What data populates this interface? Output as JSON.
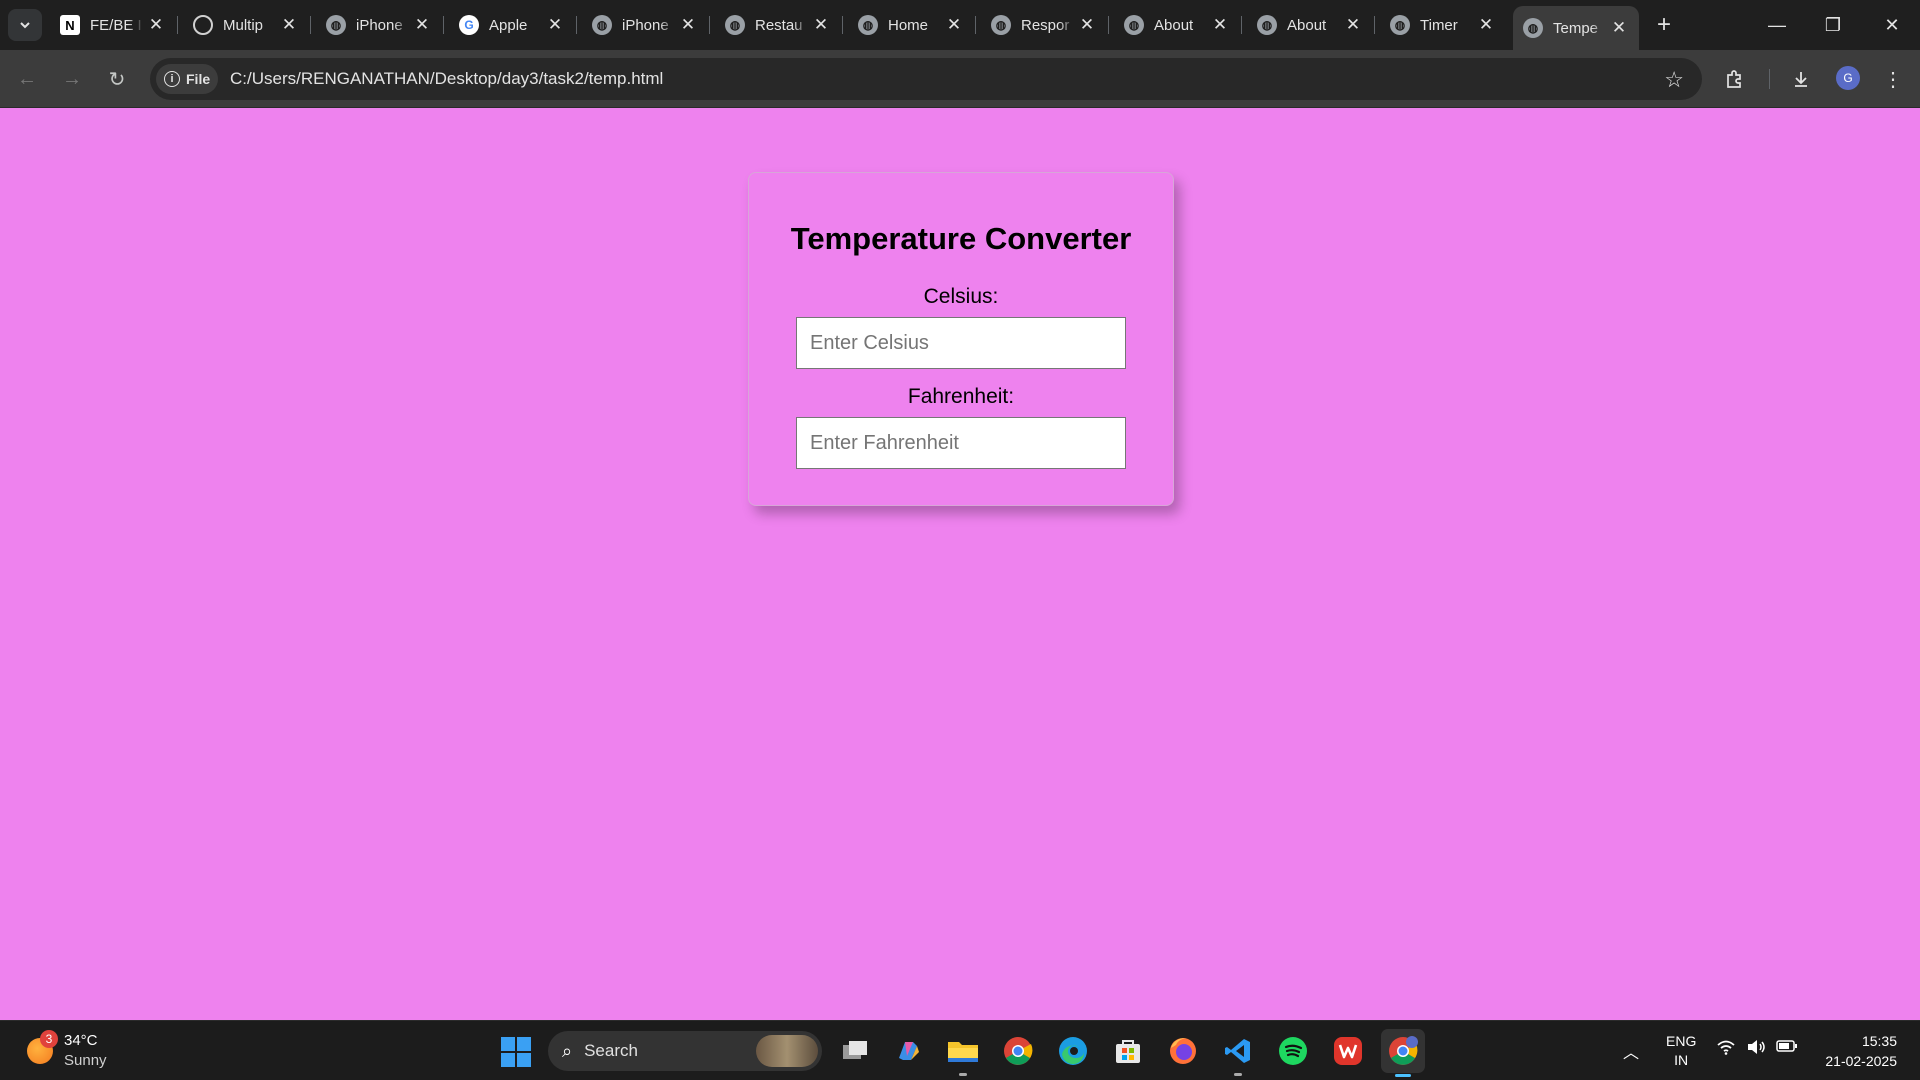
{
  "browser": {
    "tabs": [
      {
        "title": "FE/BE I",
        "favicon": "notion-icon"
      },
      {
        "title": "Multip",
        "favicon": "openai-icon"
      },
      {
        "title": "iPhone",
        "favicon": "globe-icon"
      },
      {
        "title": "Apple",
        "favicon": "google-icon"
      },
      {
        "title": "iPhone",
        "favicon": "globe-icon"
      },
      {
        "title": "Restau",
        "favicon": "globe-icon"
      },
      {
        "title": "Home",
        "favicon": "globe-icon"
      },
      {
        "title": "Respor",
        "favicon": "globe-icon"
      },
      {
        "title": "About",
        "favicon": "globe-icon"
      },
      {
        "title": "About",
        "favicon": "globe-icon"
      },
      {
        "title": "Timer",
        "favicon": "globe-icon"
      },
      {
        "title": "Tempe",
        "favicon": "globe-icon",
        "active": true
      }
    ],
    "address": {
      "chip_label": "File",
      "url": "C:/Users/RENGANATHAN/Desktop/day3/task2/temp.html"
    },
    "profile_initial": "G"
  },
  "page": {
    "background": "#ee82ee",
    "heading": "Temperature Converter",
    "celsius_label": "Celsius:",
    "celsius_placeholder": "Enter Celsius",
    "fahrenheit_label": "Fahrenheit:",
    "fahrenheit_placeholder": "Enter Fahrenheit"
  },
  "taskbar": {
    "weather": {
      "temp": "34°C",
      "condition": "Sunny",
      "badge": "3"
    },
    "search_label": "Search",
    "language": {
      "line1": "ENG",
      "line2": "IN"
    },
    "time": "15:35",
    "date": "21-02-2025"
  }
}
